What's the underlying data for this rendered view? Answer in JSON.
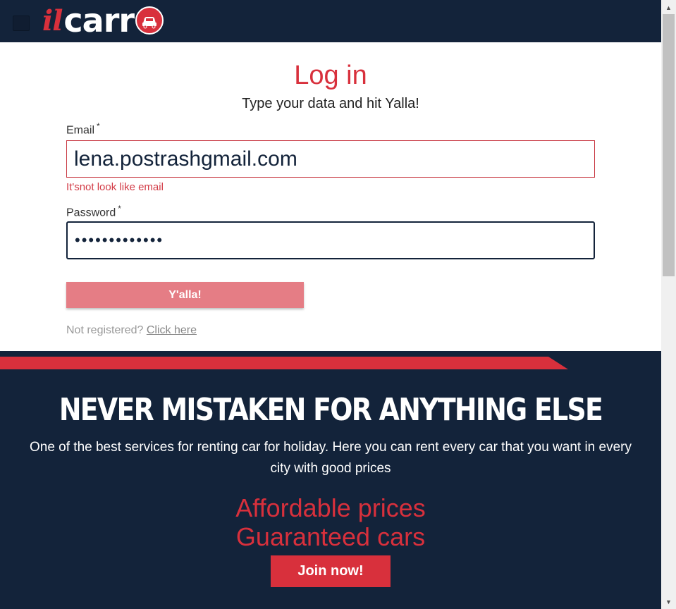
{
  "header": {
    "logo_prefix": "il",
    "logo_main": "carr"
  },
  "login": {
    "title": "Log in",
    "subtitle": "Type your data and hit Yalla!",
    "email_label": "Email",
    "email_required_mark": "*",
    "email_value": "lena.postrashgmail.com",
    "email_error": "It'snot look like email",
    "password_label": "Password",
    "password_required_mark": "*",
    "password_value": "•••••••••••••",
    "submit_label": "Y'alla!",
    "register_prompt": "Not registered?",
    "register_link": "Click here"
  },
  "promo": {
    "headline": "NEVER MISTAKEN FOR ANYTHING ELSE",
    "description": "One of the best services for renting car for holiday. Here you can rent every car that you want in every city with good prices",
    "line1": "Affordable prices",
    "line2": "Guaranteed cars",
    "join_label": "Join now!"
  },
  "icons": {
    "menu": "menu-toggle-icon",
    "logo_badge": "car-icon",
    "scroll_up": "scroll-up-arrow-icon",
    "scroll_down": "scroll-down-arrow-icon"
  },
  "colors": {
    "brand_red": "#d8303c",
    "navy": "#13233a",
    "button_disabled": "#e57d85"
  }
}
